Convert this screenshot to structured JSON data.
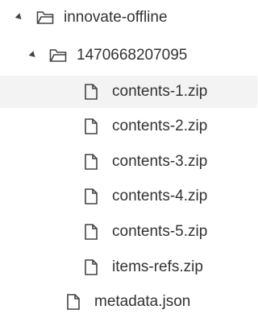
{
  "tree": {
    "root": {
      "label": "innovate-offline",
      "icon": "folder-open-icon",
      "expanded": true,
      "children": [
        {
          "label": "1470668207095",
          "icon": "folder-open-icon",
          "expanded": true,
          "children": [
            {
              "label": "contents-1.zip",
              "icon": "file-icon",
              "selected": true
            },
            {
              "label": "contents-2.zip",
              "icon": "file-icon"
            },
            {
              "label": "contents-3.zip",
              "icon": "file-icon"
            },
            {
              "label": "contents-4.zip",
              "icon": "file-icon"
            },
            {
              "label": "contents-5.zip",
              "icon": "file-icon"
            },
            {
              "label": "items-refs.zip",
              "icon": "file-icon"
            }
          ]
        },
        {
          "label": "metadata.json",
          "icon": "file-icon"
        }
      ]
    }
  },
  "colors": {
    "text": "#333333",
    "icon": "#444444",
    "selected_background": "#f3f3f3"
  }
}
